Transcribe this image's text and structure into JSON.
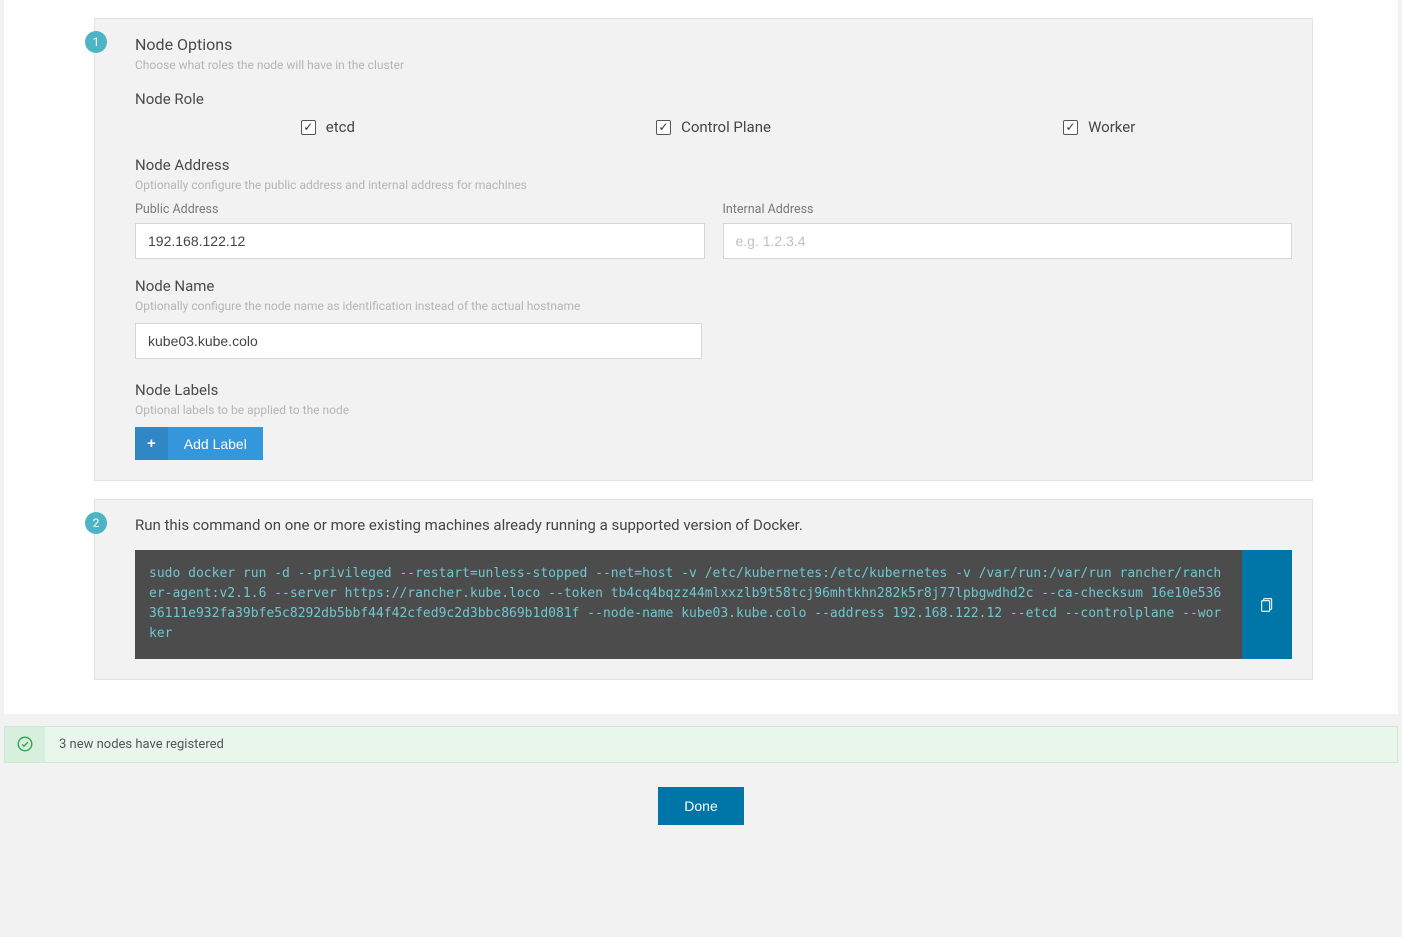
{
  "step1": {
    "badge": "1",
    "title": "Node Options",
    "subtitle": "Choose what roles the node will have in the cluster",
    "role": {
      "heading": "Node Role",
      "etcd": "etcd",
      "controlPlane": "Control Plane",
      "worker": "Worker"
    },
    "address": {
      "heading": "Node Address",
      "desc": "Optionally configure the public address and internal address for machines",
      "publicLabel": "Public Address",
      "publicValue": "192.168.122.12",
      "internalLabel": "Internal Address",
      "internalPlaceholder": "e.g. 1.2.3.4",
      "internalValue": ""
    },
    "name": {
      "heading": "Node Name",
      "desc": "Optionally configure the node name as identification instead of the actual hostname",
      "value": "kube03.kube.colo"
    },
    "labels": {
      "heading": "Node Labels",
      "desc": "Optional labels to be applied to the node",
      "addButton": "Add Label"
    }
  },
  "step2": {
    "badge": "2",
    "desc": "Run this command on one or more existing machines already running a supported version of Docker.",
    "command": "sudo docker run -d --privileged --restart=unless-stopped --net=host -v /etc/kubernetes:/etc/kubernetes -v /var/run:/var/run rancher/rancher-agent:v2.1.6 --server https://rancher.kube.loco --token tb4cq4bqzz44mlxxzlb9t58tcj96mhtkhn282k5r8j77lpbgwdhd2c --ca-checksum 16e10e53636111e932fa39bfe5c8292db5bbf44f42cfed9c2d3bbc869b1d081f --node-name kube03.kube.colo --address 192.168.122.12 --etcd --controlplane --worker"
  },
  "notice": "3 new nodes have registered",
  "doneLabel": "Done"
}
